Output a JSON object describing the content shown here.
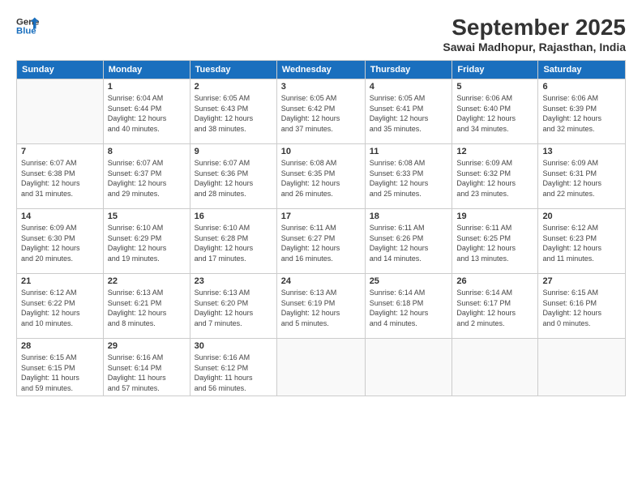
{
  "logo": {
    "line1": "General",
    "line2": "Blue"
  },
  "title": "September 2025",
  "subtitle": "Sawai Madhopur, Rajasthan, India",
  "weekdays": [
    "Sunday",
    "Monday",
    "Tuesday",
    "Wednesday",
    "Thursday",
    "Friday",
    "Saturday"
  ],
  "weeks": [
    [
      {
        "day": "",
        "info": ""
      },
      {
        "day": "1",
        "info": "Sunrise: 6:04 AM\nSunset: 6:44 PM\nDaylight: 12 hours\nand 40 minutes."
      },
      {
        "day": "2",
        "info": "Sunrise: 6:05 AM\nSunset: 6:43 PM\nDaylight: 12 hours\nand 38 minutes."
      },
      {
        "day": "3",
        "info": "Sunrise: 6:05 AM\nSunset: 6:42 PM\nDaylight: 12 hours\nand 37 minutes."
      },
      {
        "day": "4",
        "info": "Sunrise: 6:05 AM\nSunset: 6:41 PM\nDaylight: 12 hours\nand 35 minutes."
      },
      {
        "day": "5",
        "info": "Sunrise: 6:06 AM\nSunset: 6:40 PM\nDaylight: 12 hours\nand 34 minutes."
      },
      {
        "day": "6",
        "info": "Sunrise: 6:06 AM\nSunset: 6:39 PM\nDaylight: 12 hours\nand 32 minutes."
      }
    ],
    [
      {
        "day": "7",
        "info": "Sunrise: 6:07 AM\nSunset: 6:38 PM\nDaylight: 12 hours\nand 31 minutes."
      },
      {
        "day": "8",
        "info": "Sunrise: 6:07 AM\nSunset: 6:37 PM\nDaylight: 12 hours\nand 29 minutes."
      },
      {
        "day": "9",
        "info": "Sunrise: 6:07 AM\nSunset: 6:36 PM\nDaylight: 12 hours\nand 28 minutes."
      },
      {
        "day": "10",
        "info": "Sunrise: 6:08 AM\nSunset: 6:35 PM\nDaylight: 12 hours\nand 26 minutes."
      },
      {
        "day": "11",
        "info": "Sunrise: 6:08 AM\nSunset: 6:33 PM\nDaylight: 12 hours\nand 25 minutes."
      },
      {
        "day": "12",
        "info": "Sunrise: 6:09 AM\nSunset: 6:32 PM\nDaylight: 12 hours\nand 23 minutes."
      },
      {
        "day": "13",
        "info": "Sunrise: 6:09 AM\nSunset: 6:31 PM\nDaylight: 12 hours\nand 22 minutes."
      }
    ],
    [
      {
        "day": "14",
        "info": "Sunrise: 6:09 AM\nSunset: 6:30 PM\nDaylight: 12 hours\nand 20 minutes."
      },
      {
        "day": "15",
        "info": "Sunrise: 6:10 AM\nSunset: 6:29 PM\nDaylight: 12 hours\nand 19 minutes."
      },
      {
        "day": "16",
        "info": "Sunrise: 6:10 AM\nSunset: 6:28 PM\nDaylight: 12 hours\nand 17 minutes."
      },
      {
        "day": "17",
        "info": "Sunrise: 6:11 AM\nSunset: 6:27 PM\nDaylight: 12 hours\nand 16 minutes."
      },
      {
        "day": "18",
        "info": "Sunrise: 6:11 AM\nSunset: 6:26 PM\nDaylight: 12 hours\nand 14 minutes."
      },
      {
        "day": "19",
        "info": "Sunrise: 6:11 AM\nSunset: 6:25 PM\nDaylight: 12 hours\nand 13 minutes."
      },
      {
        "day": "20",
        "info": "Sunrise: 6:12 AM\nSunset: 6:23 PM\nDaylight: 12 hours\nand 11 minutes."
      }
    ],
    [
      {
        "day": "21",
        "info": "Sunrise: 6:12 AM\nSunset: 6:22 PM\nDaylight: 12 hours\nand 10 minutes."
      },
      {
        "day": "22",
        "info": "Sunrise: 6:13 AM\nSunset: 6:21 PM\nDaylight: 12 hours\nand 8 minutes."
      },
      {
        "day": "23",
        "info": "Sunrise: 6:13 AM\nSunset: 6:20 PM\nDaylight: 12 hours\nand 7 minutes."
      },
      {
        "day": "24",
        "info": "Sunrise: 6:13 AM\nSunset: 6:19 PM\nDaylight: 12 hours\nand 5 minutes."
      },
      {
        "day": "25",
        "info": "Sunrise: 6:14 AM\nSunset: 6:18 PM\nDaylight: 12 hours\nand 4 minutes."
      },
      {
        "day": "26",
        "info": "Sunrise: 6:14 AM\nSunset: 6:17 PM\nDaylight: 12 hours\nand 2 minutes."
      },
      {
        "day": "27",
        "info": "Sunrise: 6:15 AM\nSunset: 6:16 PM\nDaylight: 12 hours\nand 0 minutes."
      }
    ],
    [
      {
        "day": "28",
        "info": "Sunrise: 6:15 AM\nSunset: 6:15 PM\nDaylight: 11 hours\nand 59 minutes."
      },
      {
        "day": "29",
        "info": "Sunrise: 6:16 AM\nSunset: 6:14 PM\nDaylight: 11 hours\nand 57 minutes."
      },
      {
        "day": "30",
        "info": "Sunrise: 6:16 AM\nSunset: 6:12 PM\nDaylight: 11 hours\nand 56 minutes."
      },
      {
        "day": "",
        "info": ""
      },
      {
        "day": "",
        "info": ""
      },
      {
        "day": "",
        "info": ""
      },
      {
        "day": "",
        "info": ""
      }
    ]
  ]
}
